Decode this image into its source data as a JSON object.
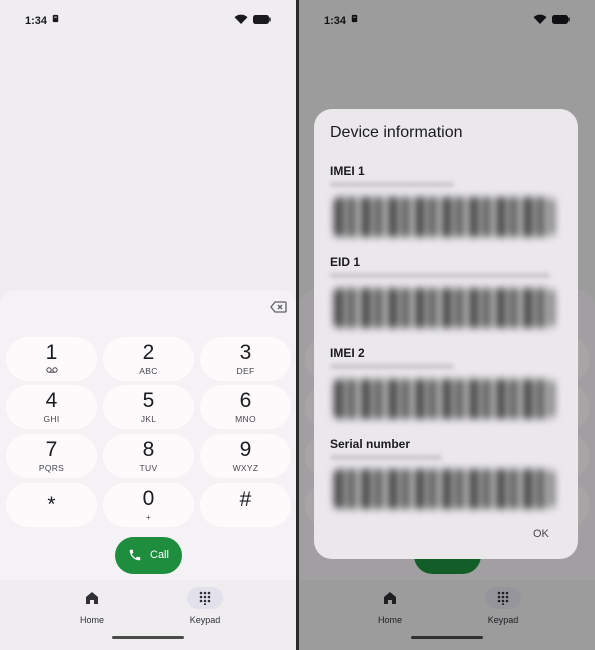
{
  "status": {
    "time": "1:34"
  },
  "keypad": {
    "keys": [
      {
        "digit": "1",
        "letters": ""
      },
      {
        "digit": "2",
        "letters": "ABC"
      },
      {
        "digit": "3",
        "letters": "DEF"
      },
      {
        "digit": "4",
        "letters": "GHI"
      },
      {
        "digit": "5",
        "letters": "JKL"
      },
      {
        "digit": "6",
        "letters": "MNO"
      },
      {
        "digit": "7",
        "letters": "PQRS"
      },
      {
        "digit": "8",
        "letters": "TUV"
      },
      {
        "digit": "9",
        "letters": "WXYZ"
      },
      {
        "digit": "*",
        "letters": ""
      },
      {
        "digit": "0",
        "letters": "+"
      },
      {
        "digit": "#",
        "letters": ""
      }
    ],
    "call_label": "Call"
  },
  "nav": {
    "home_label": "Home",
    "keypad_label": "Keypad"
  },
  "dialog": {
    "title": "Device information",
    "fields": [
      {
        "label": "IMEI 1"
      },
      {
        "label": "EID 1"
      },
      {
        "label": "IMEI 2"
      },
      {
        "label": "Serial number"
      }
    ],
    "ok_label": "OK"
  },
  "colors": {
    "call_green": "#1e8e3e",
    "background": "#efedef",
    "key": "#fdfafc"
  },
  "icons": [
    "voicemail-icon",
    "backspace-icon",
    "phone-icon",
    "home-icon",
    "keypad-dots-icon",
    "wifi-icon",
    "battery-icon"
  ]
}
